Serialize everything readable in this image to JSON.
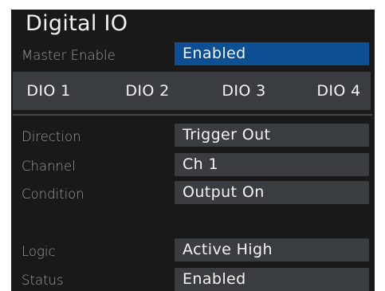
{
  "header": {
    "title": "Digital IO"
  },
  "master_enable": {
    "label": "Master Enable",
    "value": "Enabled"
  },
  "tabs": [
    {
      "label": "DIO 1"
    },
    {
      "label": "DIO 2"
    },
    {
      "label": "DIO 3"
    },
    {
      "label": "DIO 4"
    }
  ],
  "settings": {
    "direction": {
      "label": "Direction",
      "value": "Trigger Out"
    },
    "channel": {
      "label": "Channel",
      "value": "Ch 1"
    },
    "condition": {
      "label": "Condition",
      "value": "Output On"
    },
    "logic": {
      "label": "Logic",
      "value": "Active High"
    },
    "status": {
      "label": "Status",
      "value": "Enabled"
    }
  },
  "colors": {
    "background": "#191919",
    "field": "#3a3d40",
    "selected_field": "#0d4f92",
    "label_text": "#9c9c9c",
    "value_text": "#f4f4f4"
  }
}
